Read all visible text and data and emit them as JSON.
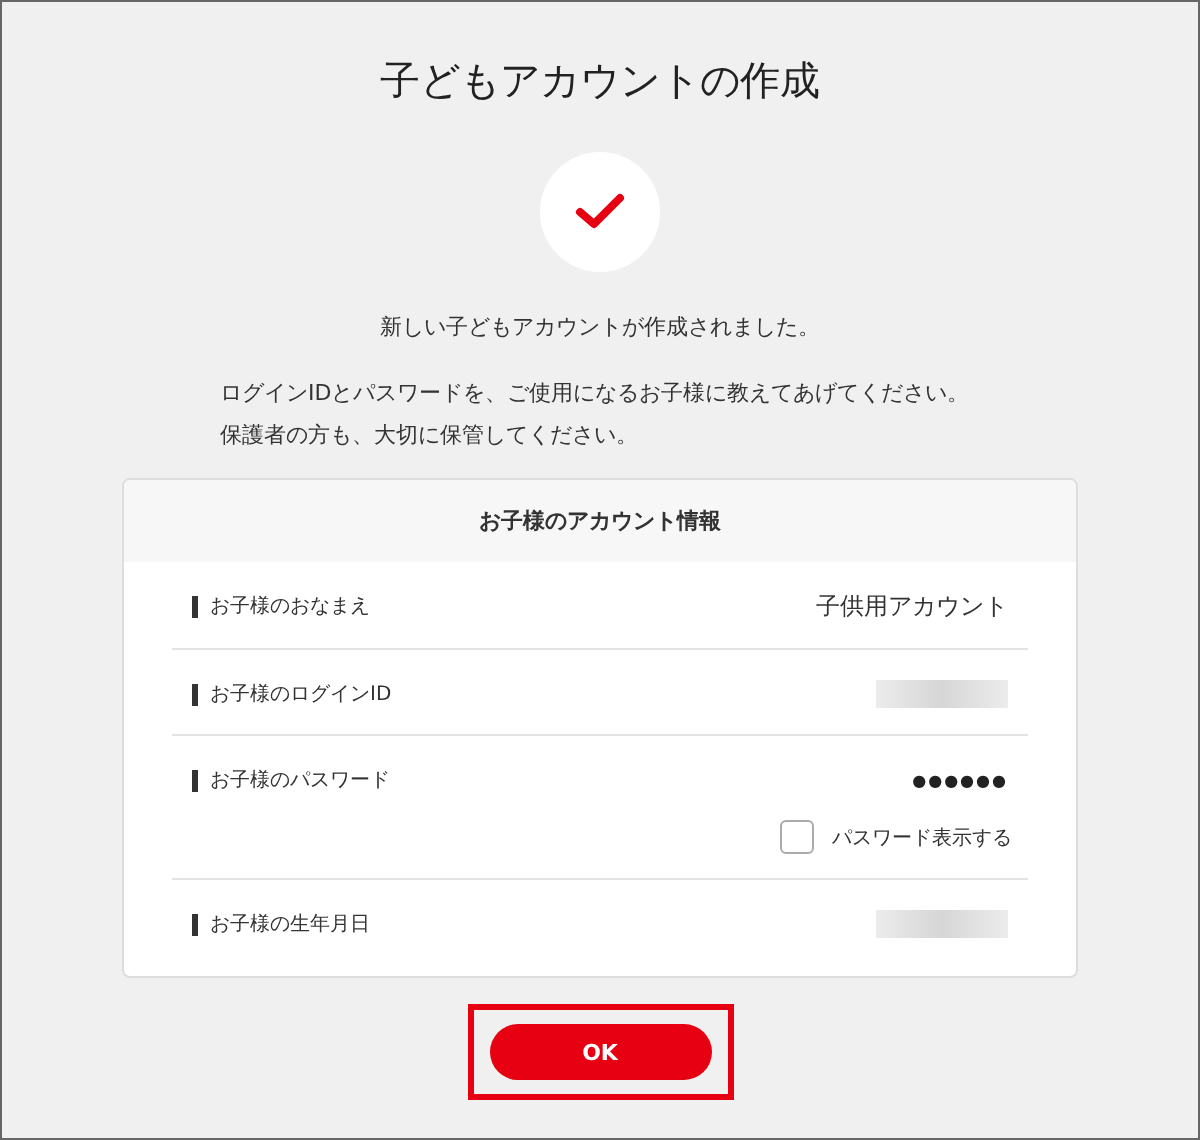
{
  "title": "子どもアカウントの作成",
  "message": "新しい子どもアカウントが作成されました。",
  "instructions": [
    "ログインIDとパスワードを、ご使用になるお子様に教えてあげてください。",
    "保護者の方も、大切に保管してください。"
  ],
  "card": {
    "title": "お子様のアカウント情報",
    "rows": [
      {
        "kind": "text",
        "label": "お子様のおなまえ",
        "value": "子供用アカウント"
      },
      {
        "kind": "hidden",
        "label": "お子様のログインID"
      },
      {
        "kind": "password",
        "label": "お子様のパスワード",
        "value": "●●●●●●",
        "toggle": {
          "label": "パスワード表示する",
          "checked": false
        }
      },
      {
        "kind": "hidden",
        "label": "お子様の生年月日"
      }
    ]
  },
  "ok_button": {
    "label": "OK",
    "highlighted": true
  }
}
